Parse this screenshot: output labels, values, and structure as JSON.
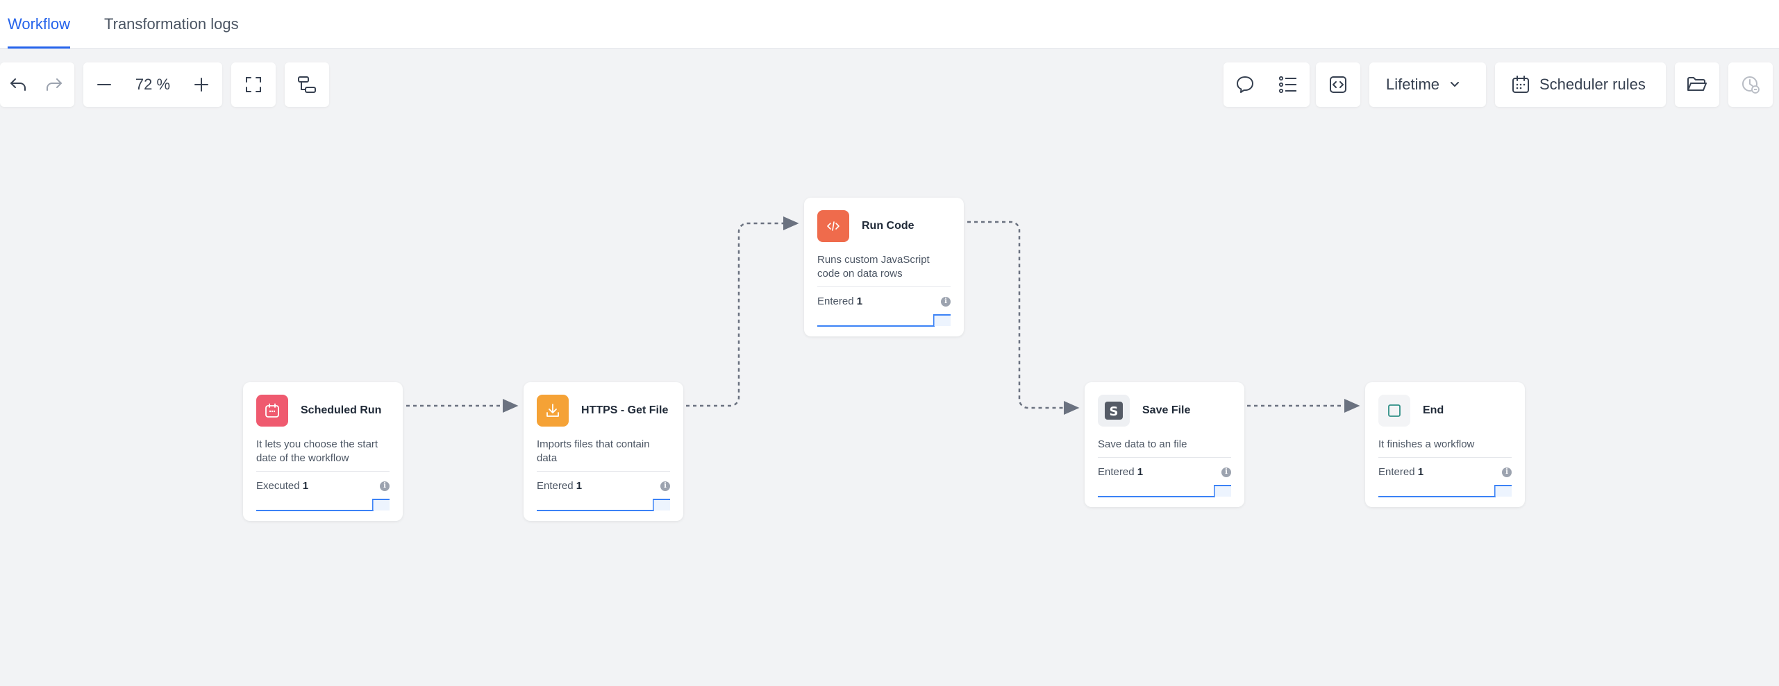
{
  "tabs": [
    {
      "label": "Workflow",
      "active": true
    },
    {
      "label": "Transformation logs",
      "active": false
    }
  ],
  "toolbar": {
    "zoom_value": "72 %",
    "lifetime_label": "Lifetime",
    "scheduler_label": "Scheduler rules",
    "icons": [
      "undo-icon",
      "redo-icon",
      "zoom-out-icon",
      "zoom-in-icon",
      "fit-view-icon",
      "auto-layout-icon",
      "comment-icon",
      "list-icon",
      "code-icon",
      "chevron-down-icon",
      "calendar-icon",
      "folder-open-icon",
      "history-icon"
    ]
  },
  "nodes": [
    {
      "id": "scheduled-run",
      "title": "Scheduled Run",
      "desc": "It lets you choose the start date of the workflow",
      "stat_label": "Executed",
      "stat_value": "1",
      "icon": "calendar-icon",
      "color": "#ef5a6f"
    },
    {
      "id": "https-get-file",
      "title": "HTTPS - Get File",
      "desc": "Imports files that contain data",
      "stat_label": "Entered",
      "stat_value": "1",
      "icon": "download-icon",
      "color": "#f5a236"
    },
    {
      "id": "run-code",
      "title": "Run Code",
      "desc": "Runs custom JavaScript code on data rows",
      "stat_label": "Entered",
      "stat_value": "1",
      "icon": "code-icon",
      "color": "#ef6b4c"
    },
    {
      "id": "save-file",
      "title": "Save File",
      "desc": "Save data to an file",
      "stat_label": "Entered",
      "stat_value": "1",
      "icon": "save-file-icon",
      "color": "#555b66"
    },
    {
      "id": "end",
      "title": "End",
      "desc": "It finishes a workflow",
      "stat_label": "Entered",
      "stat_value": "1",
      "icon": "square-icon",
      "color": "#f3f4f6"
    }
  ],
  "colors": {
    "accent": "#2563eb",
    "spark": "#3b82f6",
    "connector": "#6b7280"
  }
}
